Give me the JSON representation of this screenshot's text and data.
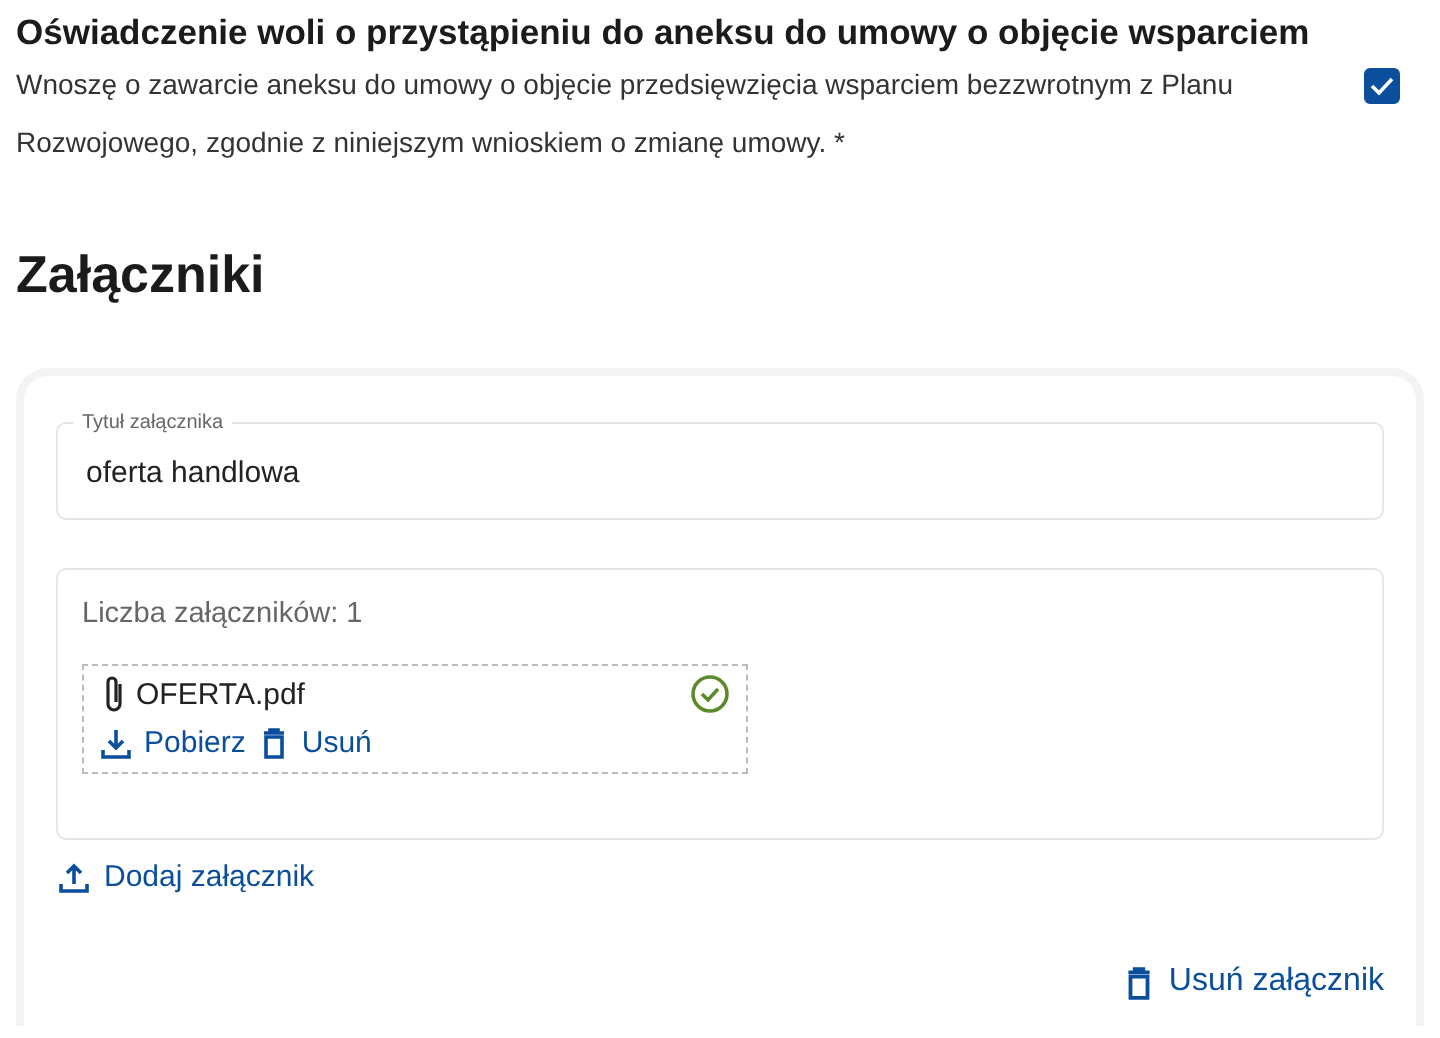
{
  "declaration": {
    "title": "Oświadczenie woli o przystąpieniu do aneksu do umowy o objęcie wsparciem",
    "text": "Wnoszę o zawarcie aneksu do umowy o objęcie przedsięwzięcia wsparciem bezzwrotnym z Planu Rozwojowego, zgodnie z niniejszym wnioskiem o zmianę umowy. *",
    "checked": true
  },
  "section_title": "Załączniki",
  "attachment": {
    "title_field": {
      "label": "Tytuł załącznika",
      "value": "oferta handlowa"
    },
    "count_label": "Liczba załączników: 1",
    "files": [
      {
        "name": "OFERTA.pdf",
        "verified": true,
        "download": "Pobierz",
        "remove": "Usuń"
      }
    ],
    "add": "Dodaj załącznik",
    "remove": "Usuń załącznik"
  }
}
